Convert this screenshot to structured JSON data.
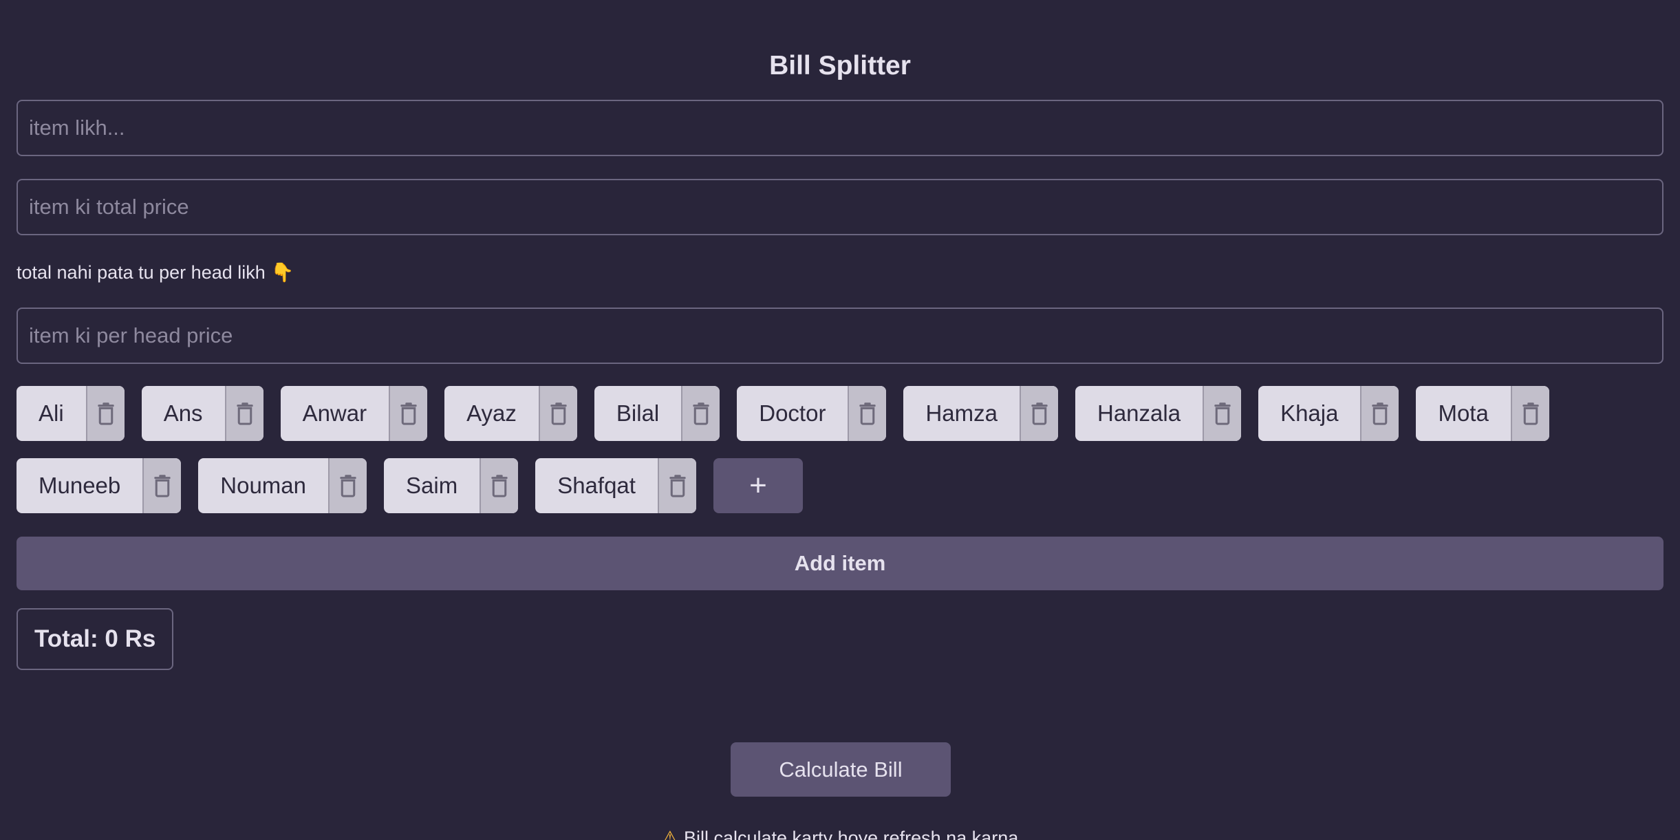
{
  "title": "Bill Splitter",
  "form": {
    "item_placeholder": "item likh...",
    "total_price_placeholder": "item ki total price",
    "hint_text": "total nahi pata tu per head likh",
    "hint_emoji": "👇",
    "per_head_placeholder": "item ki per head price"
  },
  "people": {
    "row1": [
      {
        "name": "Ali"
      },
      {
        "name": "Ans"
      },
      {
        "name": "Anwar"
      },
      {
        "name": "Ayaz"
      },
      {
        "name": "Bilal"
      },
      {
        "name": "Doctor"
      },
      {
        "name": "Hamza"
      },
      {
        "name": "Hanzala"
      },
      {
        "name": "Khaja"
      },
      {
        "name": "Mota"
      }
    ],
    "row2": [
      {
        "name": "Muneeb"
      },
      {
        "name": "Nouman"
      },
      {
        "name": "Saim"
      },
      {
        "name": "Shafqat"
      }
    ],
    "add_person_label": "+",
    "delete_icon": "trash-icon"
  },
  "actions": {
    "add_item_label": "Add item",
    "calculate_label": "Calculate Bill"
  },
  "summary": {
    "total_text": "Total: 0 Rs"
  },
  "footer": {
    "warning_icon": "⚠",
    "warning_text": "Bill calculate karty hoye refresh na karna"
  },
  "colors": {
    "background": "#29253a",
    "accent": "#5c5473",
    "chip": "#dedbe6",
    "text": "#e6e2ee"
  }
}
